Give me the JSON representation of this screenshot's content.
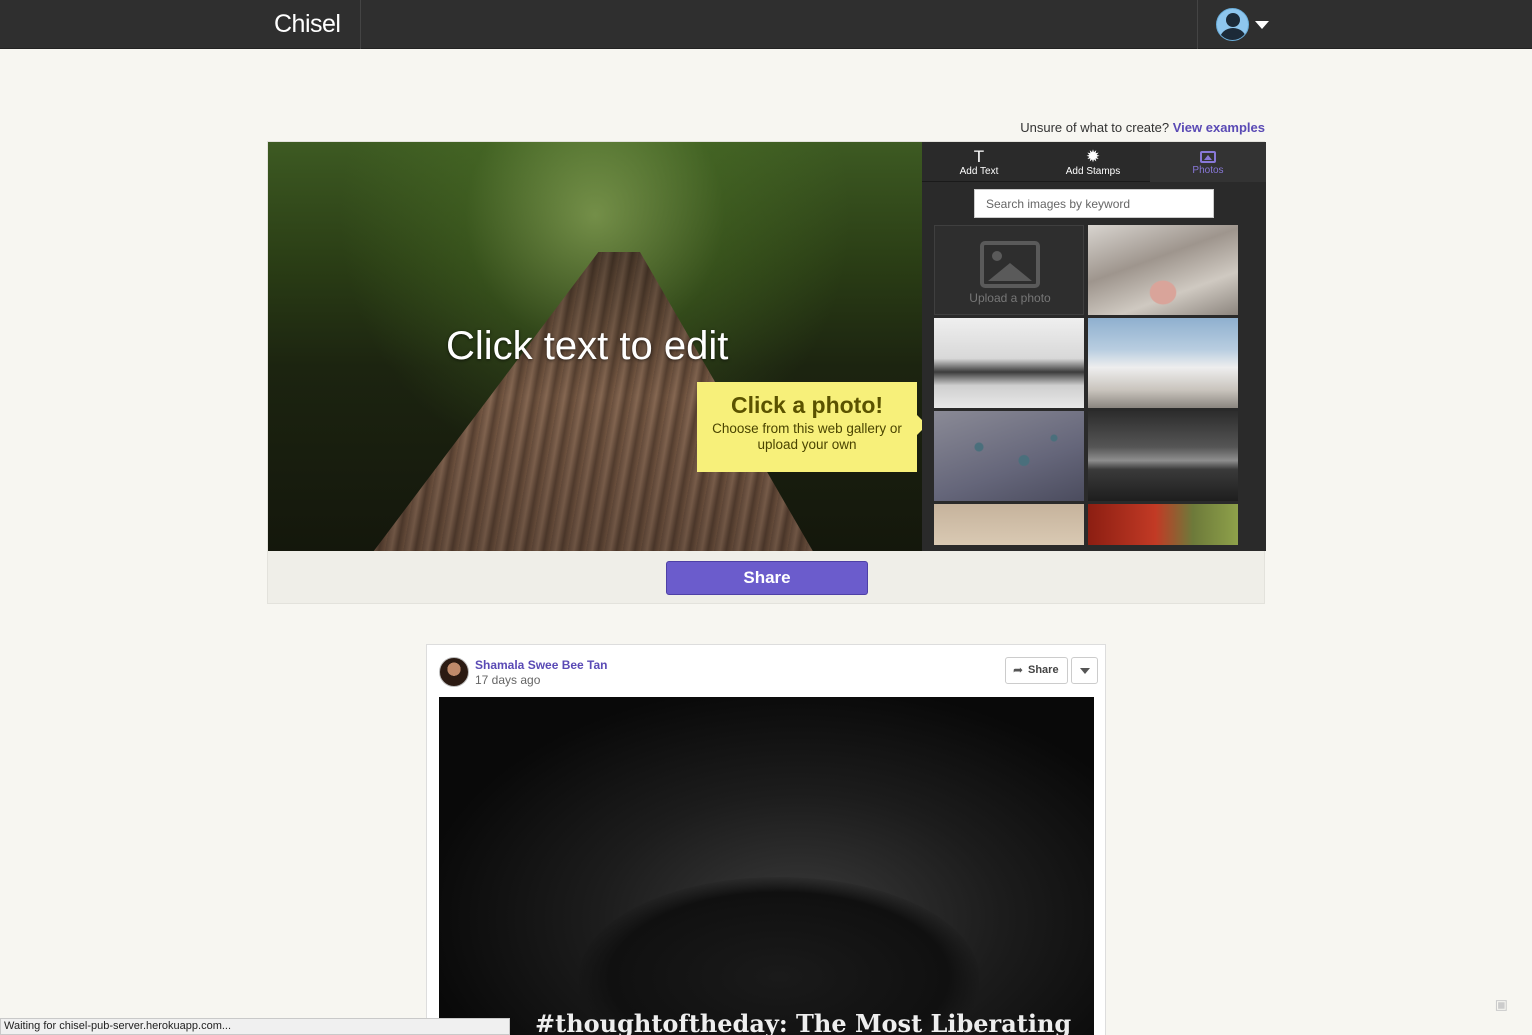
{
  "app": {
    "brand": "Chisel"
  },
  "prompt": {
    "text": "Unsure of what to create?",
    "link": "View examples"
  },
  "editor": {
    "canvas_text": "Click text to edit",
    "tooltip": {
      "title": "Click a photo!",
      "subtitle": "Choose from this web gallery or upload your own"
    },
    "tabs": [
      {
        "label": "Add Text",
        "icon": "T"
      },
      {
        "label": "Add Stamps",
        "icon": "✹"
      },
      {
        "label": "Photos"
      }
    ],
    "search_placeholder": "Search images by keyword",
    "upload_label": "Upload a photo",
    "share_label": "Share"
  },
  "feed": {
    "author": "Shamala Swee Bee Tan",
    "time": "17 days ago",
    "share_label": "Share",
    "caption": "#thoughtoftheday: The Most Liberating"
  },
  "status_bar": "Waiting for chisel-pub-server.herokuapp.com...",
  "colors": {
    "accent": "#6b5ccc",
    "tooltip": "#f7f07a",
    "topbar": "#2f2f2f"
  }
}
